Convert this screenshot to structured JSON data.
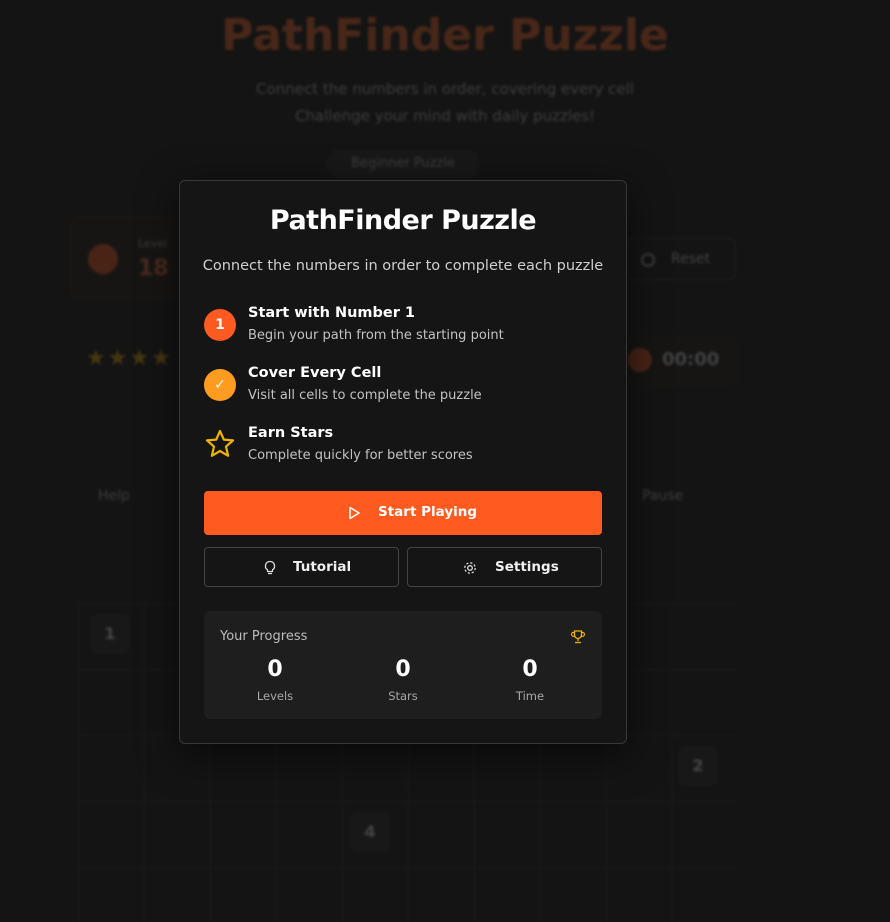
{
  "background": {
    "title": "PathFinder Puzzle",
    "subtitle_line1": "Connect the numbers in order, covering every cell",
    "subtitle_line2": "Challenge your mind with daily puzzles!",
    "pill": "Beginner Puzzle",
    "level_label": "Level",
    "level_value": "18",
    "reset_label": "Reset",
    "stars": "★★★★",
    "timer": "00:00",
    "help_label": "Help",
    "pause_label": "Pause",
    "grid_numbers": [
      "1",
      "2",
      "4"
    ]
  },
  "modal": {
    "title": "PathFinder Puzzle",
    "subtitle": "Connect the numbers in order to complete each puzzle",
    "steps": [
      {
        "badge": "1",
        "title": "Start with Number 1",
        "desc": "Begin your path from the starting point"
      },
      {
        "badge": "✓",
        "title": "Cover Every Cell",
        "desc": "Visit all cells to complete the puzzle"
      },
      {
        "icon": "star-icon",
        "title": "Earn Stars",
        "desc": "Complete quickly for better scores"
      }
    ],
    "start_button": "Start Playing",
    "tutorial_button": "Tutorial",
    "settings_button": "Settings",
    "progress": {
      "label": "Your Progress",
      "levels_value": "0",
      "levels_caption": "Levels",
      "stars_value": "0",
      "stars_caption": "Stars",
      "time_value": "0",
      "time_caption": "Time"
    }
  },
  "colors": {
    "accent": "#ff5a1f",
    "accent_secondary": "#ff9b1f",
    "star": "#f0b400",
    "modal_bg": "#151515",
    "page_bg": "#141414"
  }
}
